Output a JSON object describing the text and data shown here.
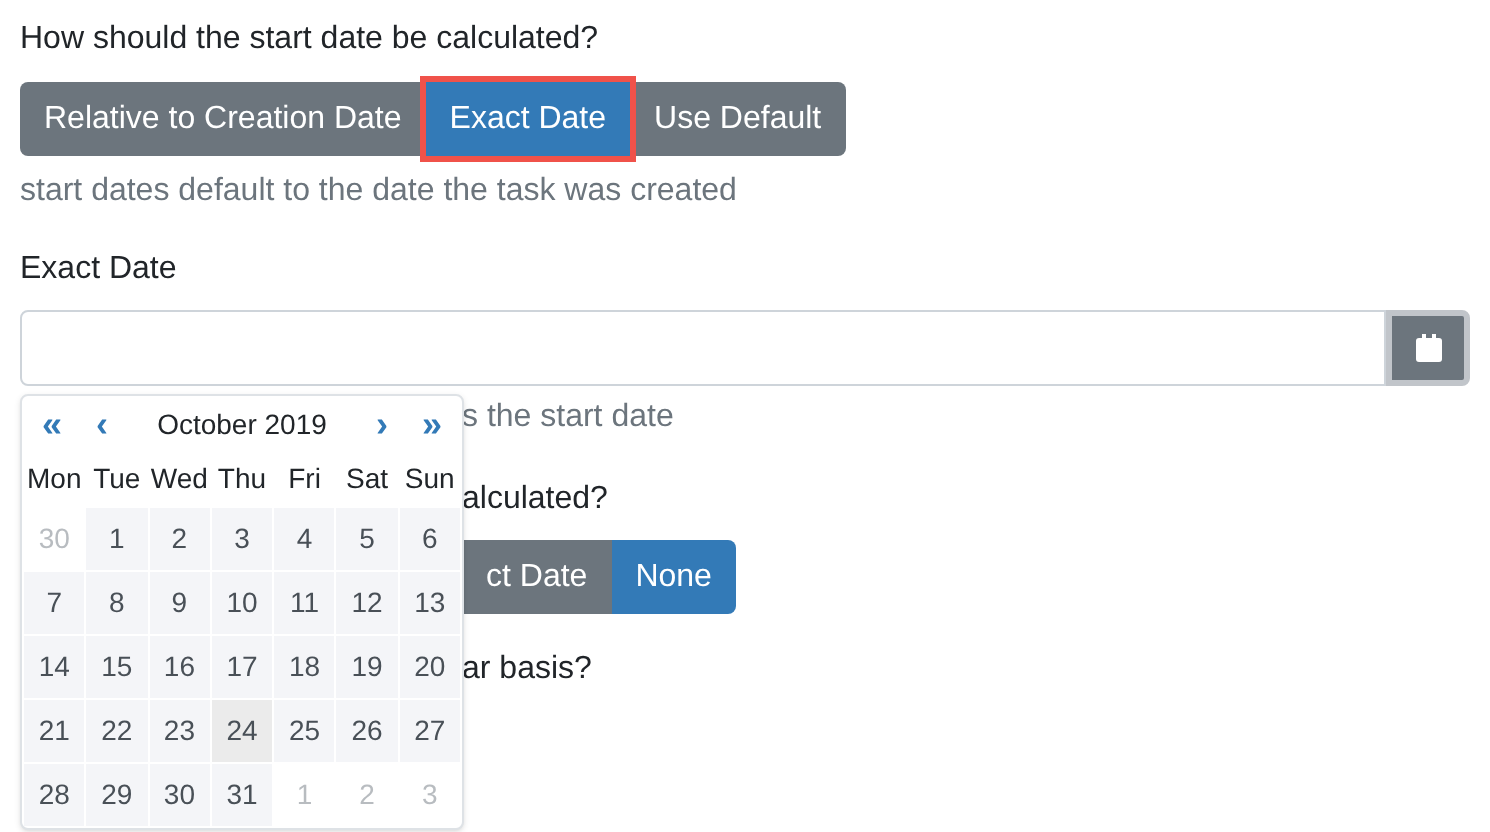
{
  "start_question": "How should the start date be calculated?",
  "start_options": [
    {
      "label": "Relative to Creation Date",
      "selected": false,
      "highlighted": false
    },
    {
      "label": "Exact Date",
      "selected": true,
      "highlighted": true
    },
    {
      "label": "Use Default",
      "selected": false,
      "highlighted": false
    }
  ],
  "start_help": "start dates default to the date the task was created",
  "exact_date": {
    "label": "Exact Date"
  },
  "calendar": {
    "prev_year": "«",
    "prev_month": "‹",
    "month": "October 2019",
    "next_month": "›",
    "next_year": "»",
    "weekdays": [
      "Mon",
      "Tue",
      "Wed",
      "Thu",
      "Fri",
      "Sat",
      "Sun"
    ],
    "weeks": [
      [
        {
          "day": "30",
          "muted": true,
          "today": false
        },
        {
          "day": "1",
          "muted": false,
          "today": false
        },
        {
          "day": "2",
          "muted": false,
          "today": false
        },
        {
          "day": "3",
          "muted": false,
          "today": false
        },
        {
          "day": "4",
          "muted": false,
          "today": false
        },
        {
          "day": "5",
          "muted": false,
          "today": false
        },
        {
          "day": "6",
          "muted": false,
          "today": false
        }
      ],
      [
        {
          "day": "7",
          "muted": false,
          "today": false
        },
        {
          "day": "8",
          "muted": false,
          "today": false
        },
        {
          "day": "9",
          "muted": false,
          "today": false
        },
        {
          "day": "10",
          "muted": false,
          "today": false
        },
        {
          "day": "11",
          "muted": false,
          "today": false
        },
        {
          "day": "12",
          "muted": false,
          "today": false
        },
        {
          "day": "13",
          "muted": false,
          "today": false
        }
      ],
      [
        {
          "day": "14",
          "muted": false,
          "today": false
        },
        {
          "day": "15",
          "muted": false,
          "today": false
        },
        {
          "day": "16",
          "muted": false,
          "today": false
        },
        {
          "day": "17",
          "muted": false,
          "today": false
        },
        {
          "day": "18",
          "muted": false,
          "today": false
        },
        {
          "day": "19",
          "muted": false,
          "today": false
        },
        {
          "day": "20",
          "muted": false,
          "today": false
        }
      ],
      [
        {
          "day": "21",
          "muted": false,
          "today": false
        },
        {
          "day": "22",
          "muted": false,
          "today": false
        },
        {
          "day": "23",
          "muted": false,
          "today": false
        },
        {
          "day": "24",
          "muted": false,
          "today": true
        },
        {
          "day": "25",
          "muted": false,
          "today": false
        },
        {
          "day": "26",
          "muted": false,
          "today": false
        },
        {
          "day": "27",
          "muted": false,
          "today": false
        }
      ],
      [
        {
          "day": "28",
          "muted": false,
          "today": false
        },
        {
          "day": "29",
          "muted": false,
          "today": false
        },
        {
          "day": "30",
          "muted": false,
          "today": false
        },
        {
          "day": "31",
          "muted": false,
          "today": false
        },
        {
          "day": "1",
          "muted": true,
          "today": false
        },
        {
          "day": "2",
          "muted": true,
          "today": false
        },
        {
          "day": "3",
          "muted": true,
          "today": false
        }
      ]
    ]
  },
  "exact_help": "s the start date",
  "second_question": "alculated?",
  "second_options": [
    {
      "label": "ct Date",
      "selected": false
    },
    {
      "label": "None",
      "selected": true
    }
  ],
  "third_question": "ar basis?"
}
